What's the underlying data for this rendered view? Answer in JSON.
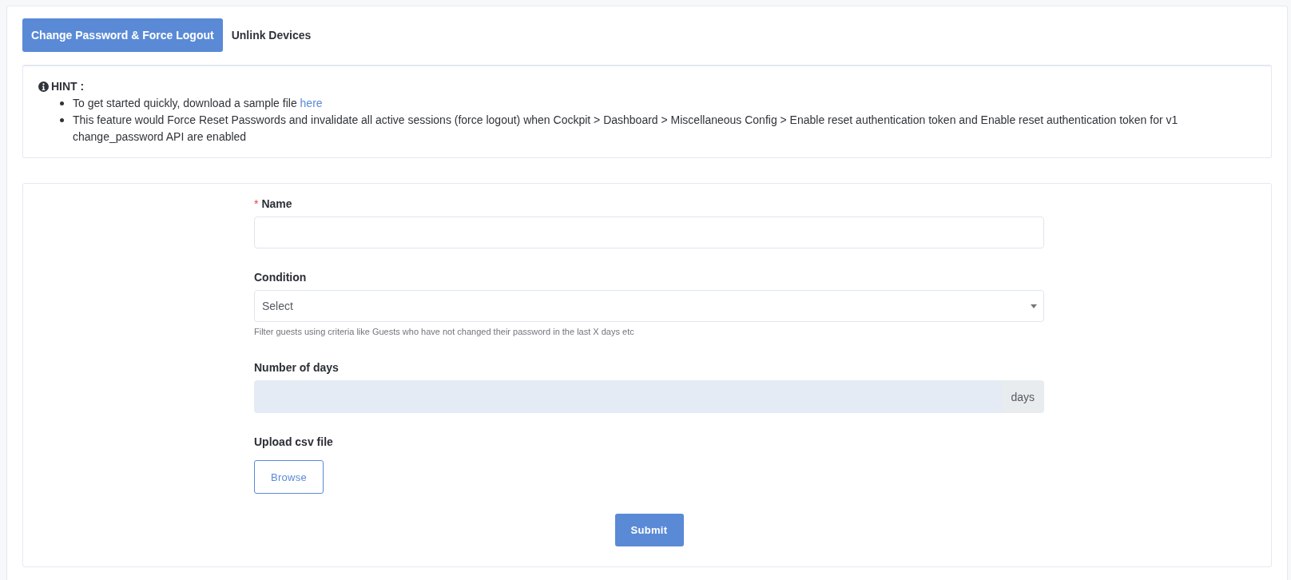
{
  "tabs": [
    {
      "label": "Change Password & Force Logout",
      "selected": true
    },
    {
      "label": "Unlink Devices",
      "selected": false
    }
  ],
  "hint": {
    "title": "HINT :",
    "items": [
      {
        "text": "To get started quickly, download a sample file",
        "link": "here"
      },
      {
        "text": "This feature would Force Reset Passwords and invalidate all active sessions (force logout) when Cockpit > Dashboard > Miscellaneous Config > Enable reset authentication token and Enable reset authentication token for v1 change_password API are enabled"
      }
    ]
  },
  "form": {
    "fields": [
      {
        "kind": "text",
        "label": "Name",
        "required_mark": "*",
        "disabled": false
      },
      {
        "kind": "select",
        "label": "Condition",
        "placeholder": "Select",
        "help": "Filter guests using criteria like Guests who have not changed their password in the last X days etc",
        "disabled": false
      },
      {
        "kind": "addon",
        "label": "Number of days",
        "addon": "days",
        "disabled": true
      },
      {
        "kind": "file",
        "label": "Upload csv file",
        "button": "Browse",
        "disabled": false
      }
    ],
    "submit": "Submit"
  }
}
